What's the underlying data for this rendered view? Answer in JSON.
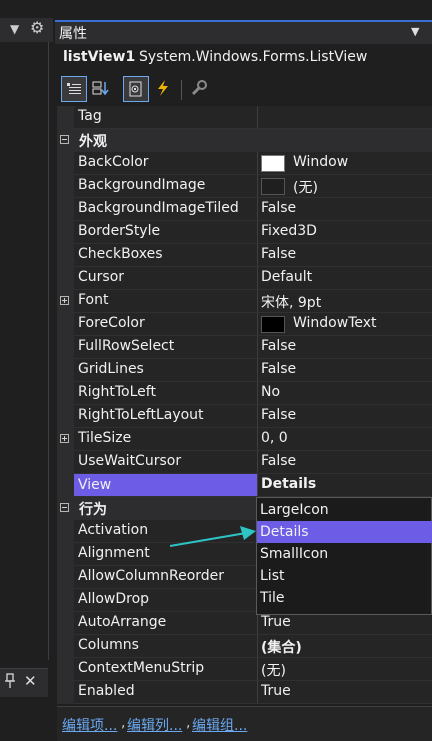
{
  "left_panel": {
    "pin_glyph": "⚲",
    "close_glyph": "✕"
  },
  "title": "属性",
  "object": {
    "name": "listView1",
    "type": "System.Windows.Forms.ListView"
  },
  "tag_row": {
    "name": "Tag",
    "value": ""
  },
  "categories": {
    "appearance": "外观",
    "behavior": "行为"
  },
  "appearance_rows": [
    {
      "name": "BackColor",
      "value": "Window"
    },
    {
      "name": "BackgroundImage",
      "value": "(无)"
    },
    {
      "name": "BackgroundImageTiled",
      "value": "False"
    },
    {
      "name": "BorderStyle",
      "value": "Fixed3D"
    },
    {
      "name": "CheckBoxes",
      "value": "False"
    },
    {
      "name": "Cursor",
      "value": "Default"
    },
    {
      "name": "Font",
      "value": "宋体, 9pt"
    },
    {
      "name": "ForeColor",
      "value": "WindowText"
    },
    {
      "name": "FullRowSelect",
      "value": "False"
    },
    {
      "name": "GridLines",
      "value": "False"
    },
    {
      "name": "RightToLeft",
      "value": "No"
    },
    {
      "name": "RightToLeftLayout",
      "value": "False"
    },
    {
      "name": "TileSize",
      "value": "0, 0"
    },
    {
      "name": "UseWaitCursor",
      "value": "False"
    },
    {
      "name": "View",
      "value": "Details"
    }
  ],
  "behavior_rows": [
    {
      "name": "Activation",
      "value": ""
    },
    {
      "name": "Alignment",
      "value": ""
    },
    {
      "name": "AllowColumnReorder",
      "value": ""
    },
    {
      "name": "AllowDrop",
      "value": ""
    },
    {
      "name": "AutoArrange",
      "value": "True"
    },
    {
      "name": "Columns",
      "value": "(集合)"
    },
    {
      "name": "ContextMenuStrip",
      "value": "(无)"
    },
    {
      "name": "Enabled",
      "value": "True"
    }
  ],
  "dropdown_options": [
    "LargeIcon",
    "Details",
    "SmallIcon",
    "List",
    "Tile"
  ],
  "dropdown_selected": "Details",
  "links": [
    "编辑项...",
    "编辑列...",
    "编辑组..."
  ],
  "colors": {
    "selection": "#6d5ce6",
    "arrow": "#2ec4c4",
    "link": "#6aa9f0",
    "backcolor_swatch": "#ffffff",
    "forecolor_swatch": "#000000",
    "bgimage_swatch": "#1f1f1f"
  }
}
